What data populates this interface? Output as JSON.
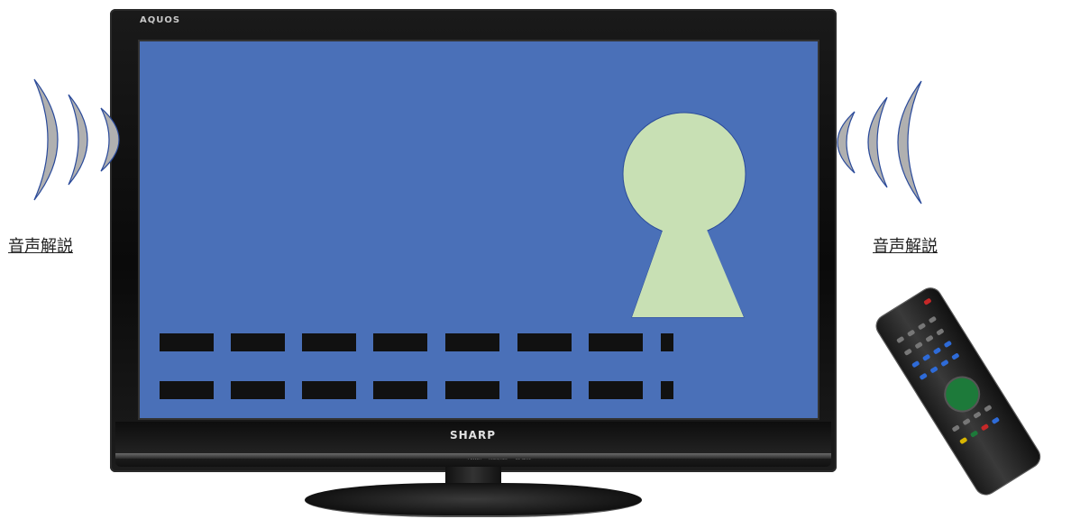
{
  "tv": {
    "brand_top": "AQUOS",
    "brand_bottom": "SHARP",
    "indicators": [
      "POWER",
      "TIMER/REC",
      "LC-32V5"
    ]
  },
  "screen": {
    "background_color": "#4a70b8",
    "keyhole_color": "#c8e0b4",
    "text_bar_rows": 2,
    "text_bars_per_row": 8
  },
  "audio": {
    "left_label": "音声解説",
    "right_label": "音声解説",
    "wave_color": "#b0b0b0",
    "wave_stroke": "#2a4a9a"
  },
  "remote": {
    "icon": "remote-control-icon"
  }
}
